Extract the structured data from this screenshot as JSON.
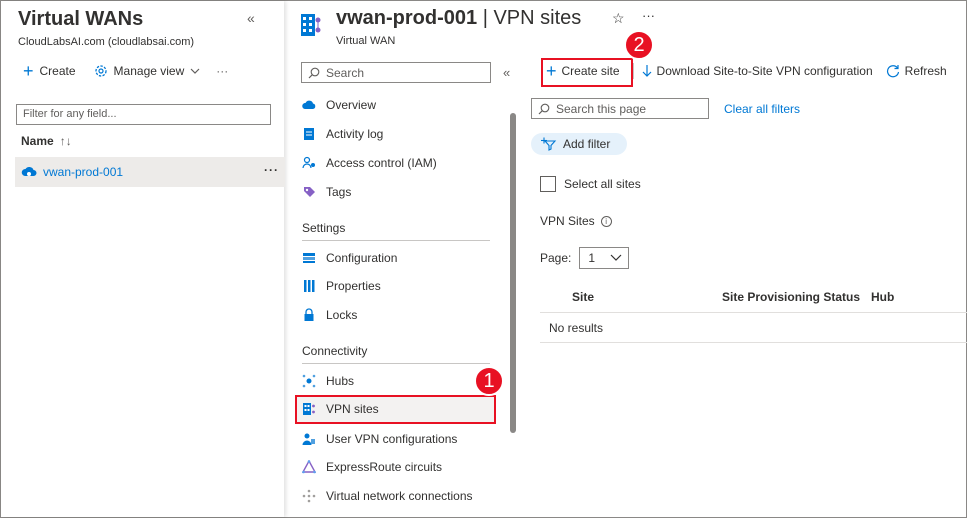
{
  "left_panel": {
    "title": "Virtual WANs",
    "subtitle": "CloudLabsAI.com (cloudlabsai.com)",
    "collapse_glyph": "«",
    "toolbar": {
      "create": "Create",
      "manage_view": "Manage view",
      "more": "···"
    },
    "filter_placeholder": "Filter for any field...",
    "column_name": "Name",
    "items": [
      {
        "name": "vwan-prod-001",
        "more": "···"
      }
    ]
  },
  "resource": {
    "name": "vwan-prod-001",
    "separator": " | ",
    "page": "VPN sites",
    "type": "Virtual WAN",
    "favorite_icon": "star-icon",
    "more": "···"
  },
  "menu": {
    "search_placeholder": "Search",
    "collapse_glyph": "«",
    "items_top": [
      {
        "label": "Overview",
        "icon": "overview-icon"
      },
      {
        "label": "Activity log",
        "icon": "activity-log-icon"
      },
      {
        "label": "Access control (IAM)",
        "icon": "iam-icon"
      },
      {
        "label": "Tags",
        "icon": "tag-icon"
      }
    ],
    "settings_header": "Settings",
    "settings_items": [
      {
        "label": "Configuration",
        "icon": "configuration-icon"
      },
      {
        "label": "Properties",
        "icon": "properties-icon"
      },
      {
        "label": "Locks",
        "icon": "lock-icon"
      }
    ],
    "connectivity_header": "Connectivity",
    "connectivity_items": [
      {
        "label": "Hubs",
        "icon": "hub-icon"
      },
      {
        "label": "VPN sites",
        "icon": "vpn-sites-icon"
      },
      {
        "label": "User VPN configurations",
        "icon": "user-vpn-icon"
      },
      {
        "label": "ExpressRoute circuits",
        "icon": "expressroute-icon"
      },
      {
        "label": "Virtual network connections",
        "icon": "vnet-connection-icon"
      }
    ]
  },
  "commands": {
    "create_site": "Create site",
    "download": "Download Site-to-Site VPN configuration",
    "refresh": "Refresh"
  },
  "content": {
    "search_placeholder": "Search this page",
    "clear_filters": "Clear all filters",
    "add_filter": "Add filter",
    "select_all": "Select all sites",
    "vpn_sites_label": "VPN Sites",
    "page_label": "Page:",
    "page_value": "1",
    "columns": [
      "Site",
      "Site Provisioning Status",
      "Hub"
    ],
    "empty_text": "No results"
  },
  "annotations": {
    "badge1": "1",
    "badge2": "2"
  },
  "colors": {
    "accent": "#0078d4",
    "highlight": "#e81123"
  }
}
